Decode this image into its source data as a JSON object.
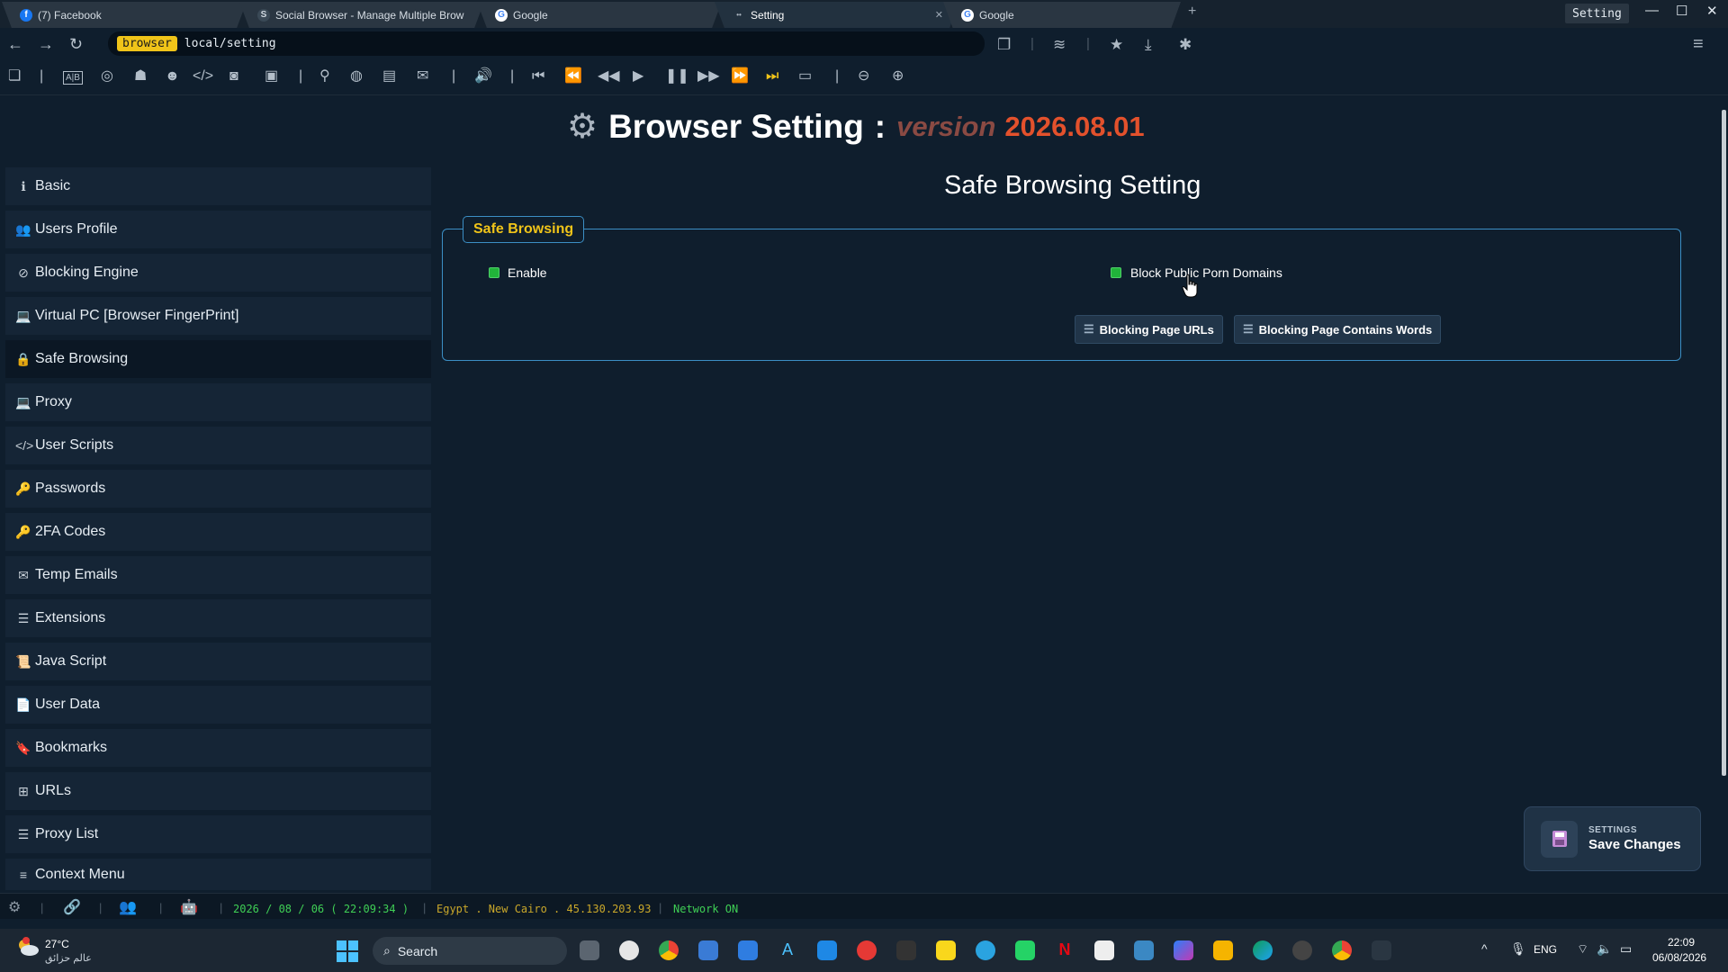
{
  "tabs": [
    {
      "label": "(7) Facebook"
    },
    {
      "label": "Social Browser - Manage Multiple Brow"
    },
    {
      "label": "Google"
    },
    {
      "label": "Setting",
      "active": true
    },
    {
      "label": "Google"
    }
  ],
  "window": {
    "label": "Setting"
  },
  "address": {
    "scheme": "browser",
    "url": "local/setting"
  },
  "header": {
    "title": "Browser Setting",
    "colon": ":",
    "version_label": "version",
    "version": "2026.08.01"
  },
  "sidebar": {
    "items": [
      {
        "label": "Basic",
        "icon": "info-circle-icon"
      },
      {
        "label": "Users Profile",
        "icon": "users-icon"
      },
      {
        "label": "Blocking Engine",
        "icon": "ban-icon"
      },
      {
        "label": "Virtual PC [Browser FingerPrint]",
        "icon": "laptop-icon"
      },
      {
        "label": "Safe Browsing",
        "icon": "lock-icon",
        "active": true
      },
      {
        "label": "Proxy",
        "icon": "laptop-icon"
      },
      {
        "label": "User Scripts",
        "icon": "code-icon"
      },
      {
        "label": "Passwords",
        "icon": "key-icon"
      },
      {
        "label": "2FA Codes",
        "icon": "key-icon"
      },
      {
        "label": "Temp Emails",
        "icon": "envelope-icon"
      },
      {
        "label": "Extensions",
        "icon": "list-icon"
      },
      {
        "label": "Java Script",
        "icon": "scroll-icon"
      },
      {
        "label": "User Data",
        "icon": "file-icon"
      },
      {
        "label": "Bookmarks",
        "icon": "bookmark-icon"
      },
      {
        "label": "URLs",
        "icon": "sitemap-icon"
      },
      {
        "label": "Proxy List",
        "icon": "list-icon"
      },
      {
        "label": "Context Menu",
        "icon": "bars-icon"
      }
    ]
  },
  "main": {
    "section_title": "Safe Browsing Setting",
    "legend": "Safe Browsing",
    "enable_label": "Enable",
    "enable_checked": true,
    "block_porn_label": "Block Public Porn Domains",
    "block_porn_checked": true,
    "btn_urls": "Blocking Page URLs",
    "btn_words": "Blocking Page Contains Words"
  },
  "save": {
    "small": "SETTINGS",
    "big": "Save Changes"
  },
  "status": {
    "datetime": "2026 / 08 / 06 ( 22:09:34 )",
    "location": "Egypt . New Cairo . 45.130.203.93",
    "network": "Network ON"
  },
  "taskbar": {
    "temp": "27°C",
    "weather_desc": "عالم حزائق",
    "search": "Search",
    "lang": "ENG",
    "time": "22:09",
    "date": "06/08/2026"
  },
  "colors": {
    "accent_yellow": "#f0c419",
    "version_red": "#e3512c",
    "border_blue": "#3b8ec4",
    "check_green": "#21b43a"
  }
}
